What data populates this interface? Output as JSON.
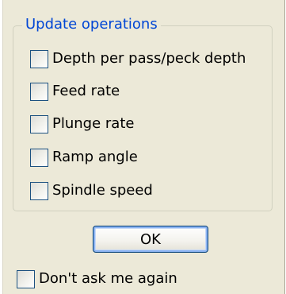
{
  "group": {
    "title": "Update operations",
    "options": [
      {
        "label": "Depth per pass/peck depth",
        "checked": false
      },
      {
        "label": "Feed rate",
        "checked": false
      },
      {
        "label": "Plunge rate",
        "checked": false
      },
      {
        "label": "Ramp angle",
        "checked": false
      },
      {
        "label": "Spindle speed",
        "checked": false
      }
    ]
  },
  "buttons": {
    "ok_label": "OK"
  },
  "dont_ask": {
    "label": "Don't ask me again",
    "checked": false
  },
  "colors": {
    "dialog_background": "#ece9d8",
    "group_title": "#0046d5",
    "checkbox_border": "#1c5180",
    "button_border": "#003c74"
  }
}
